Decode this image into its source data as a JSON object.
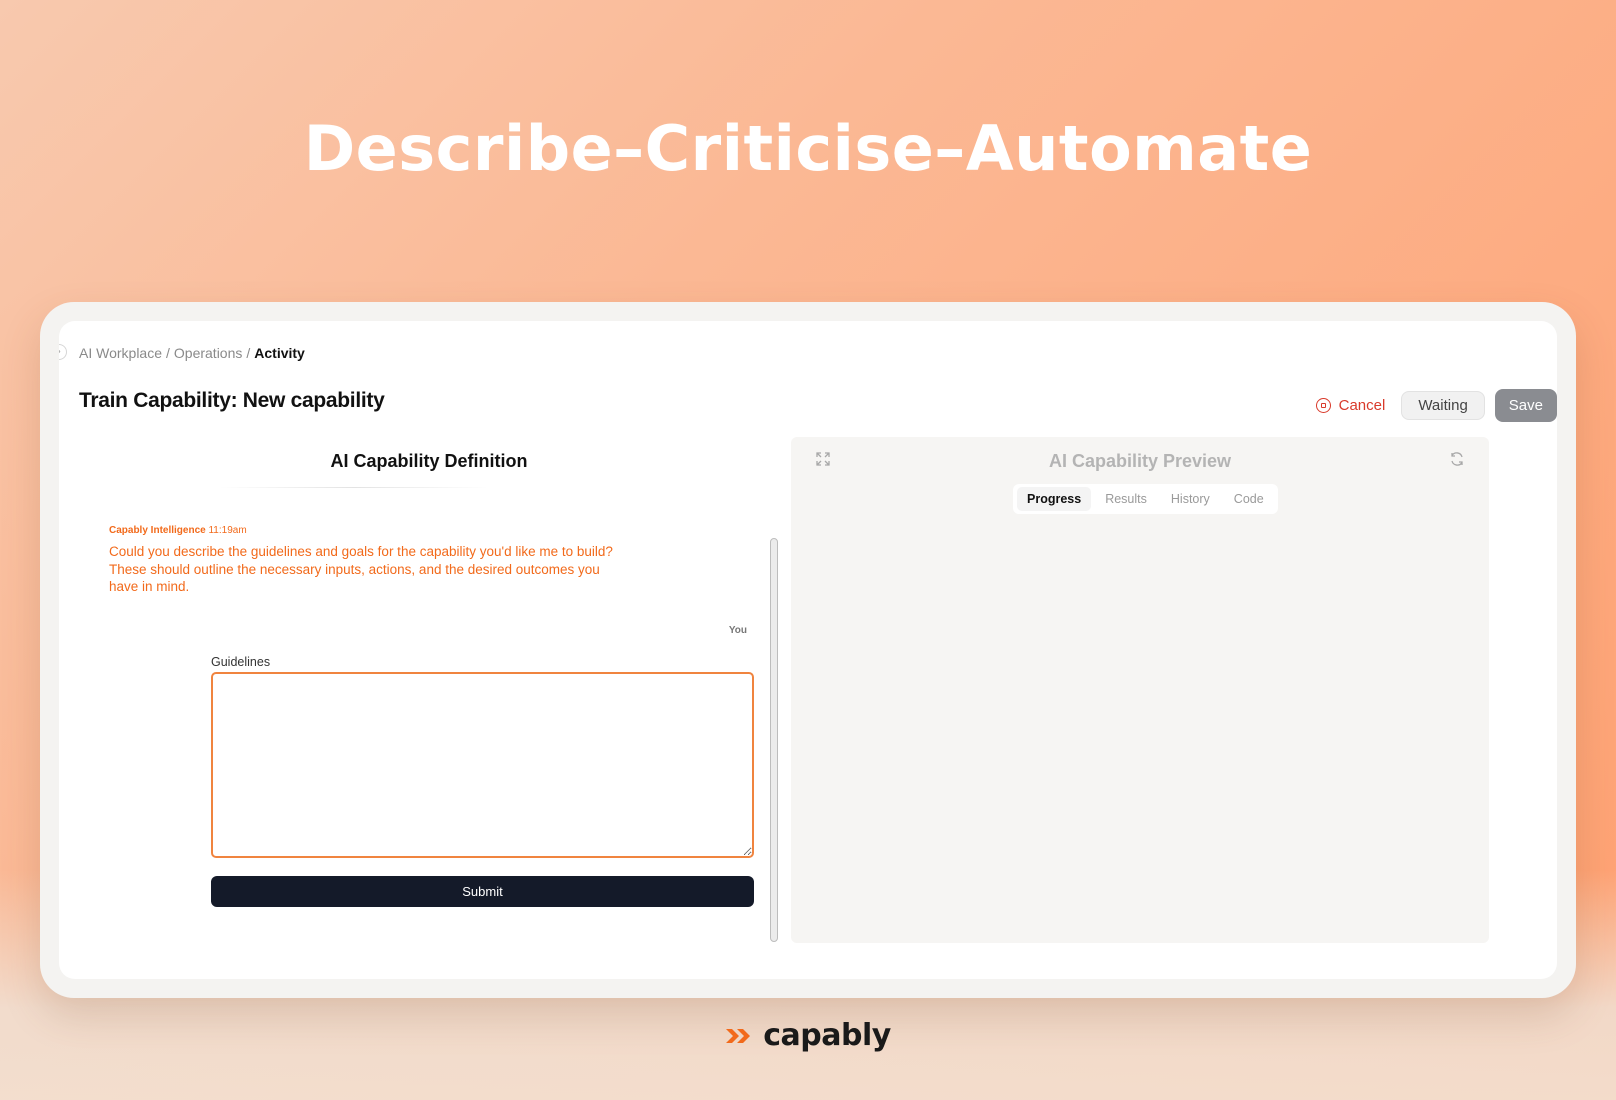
{
  "hero": {
    "title": "Describe–Criticise–Automate"
  },
  "breadcrumb": {
    "items": [
      "AI Workplace",
      "Operations"
    ],
    "current": "Activity",
    "separator": "/"
  },
  "page": {
    "title": "Train Capability: New capability"
  },
  "actions": {
    "cancel_label": "Cancel",
    "status_label": "Waiting",
    "save_label": "Save"
  },
  "definition": {
    "title": "AI Capability Definition",
    "message": {
      "sender": "Capably Intelligence",
      "time": "11:19am",
      "text": "Could you describe the guidelines and goals for the capability you'd like me to build? These should outline the necessary inputs, actions, and the desired outcomes you have in mind."
    },
    "you_label": "You",
    "guidelines_label": "Guidelines",
    "guidelines_value": "",
    "submit_label": "Submit"
  },
  "preview": {
    "title": "AI Capability Preview",
    "tabs": [
      {
        "label": "Progress",
        "active": true
      },
      {
        "label": "Results",
        "active": false
      },
      {
        "label": "History",
        "active": false
      },
      {
        "label": "Code",
        "active": false
      }
    ]
  },
  "brand": {
    "name": "capably"
  },
  "icons": {
    "cancel": "stop-circle-icon",
    "expand": "expand-icon",
    "refresh": "refresh-icon",
    "sidebar_toggle": "chevron-right-icon",
    "brand_mark": "double-play-icon"
  },
  "colors": {
    "accent": "#f26a1b",
    "cancel": "#d93a2b",
    "submit_bg": "#141a29",
    "save_bg": "#8a8c91"
  }
}
